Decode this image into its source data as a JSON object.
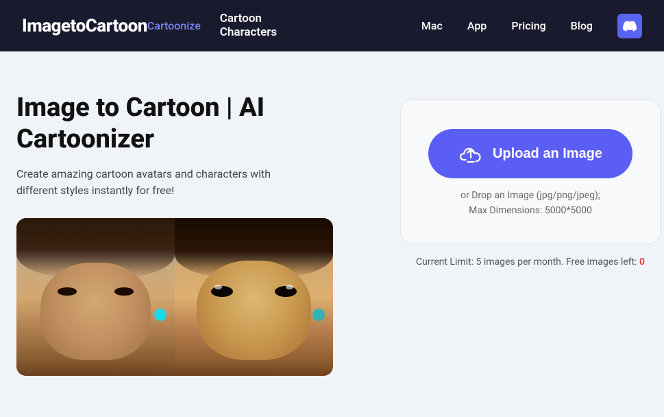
{
  "nav": {
    "brand_main": "ImagetoCartoon",
    "brand_sub": "Cartoonize",
    "cartoon_line1": "Cartoon",
    "cartoon_line2": "Characters",
    "links": [
      {
        "label": "Mac",
        "href": "#"
      },
      {
        "label": "App",
        "href": "#"
      },
      {
        "label": "Pricing",
        "href": "#"
      },
      {
        "label": "Blog",
        "href": "#"
      }
    ],
    "discord_icon": "🎮"
  },
  "hero": {
    "title": "Image to Cartoon | AI Cartoonizer",
    "subtitle": "Create amazing cartoon avatars and characters with different styles instantly for free!"
  },
  "upload": {
    "button_label": "Upload an Image",
    "drop_hint_line1": "or Drop an Image (jpg/png/jpeg);",
    "drop_hint_line2": "Max Dimensions: 5000*5000",
    "limit_text": "Current Limit: 5 images per month. Free images left:",
    "limit_count": "0"
  }
}
